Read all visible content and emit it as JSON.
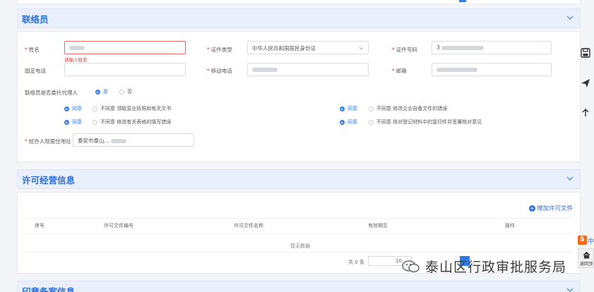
{
  "sections": {
    "contact": {
      "title": "联络员"
    },
    "license": {
      "title": "许可经营信息"
    },
    "seal": {
      "title": "印章备案信息"
    }
  },
  "contact": {
    "name_label": "姓名",
    "name_error": "请输入姓名",
    "id_type_label": "证件类型",
    "id_type_value": "中华人民共和国居民身份证",
    "id_number_label": "证件号码",
    "id_number_prefix": "3",
    "landline_label": "固定电话",
    "mobile_label": "移动电话",
    "email_label": "邮箱",
    "agent_question": "联络员是否委托代理人",
    "yes": "是",
    "no": "否",
    "agree": "同意",
    "disagree_pick_license": "不同意 领取营业执照和有关文书",
    "disagree_modify_docs": "不同意 修改企业自备文件的错误",
    "disagree_modify_forms": "不同意 修改有关表格的填写错误",
    "disagree_check_copies": "不同意 核对登记材料中的复印件并签署核对意见",
    "agent_address_label": "经办人现居住地址",
    "agent_address_value": "泰安市泰山…"
  },
  "license": {
    "add_button": "增加许可文件",
    "columns": [
      "序号",
      "许可文件编号",
      "许可文件名称",
      "有效期至",
      "操作"
    ],
    "empty_text": "暂无数据",
    "total_label": "共 0 条",
    "page_size_prefix": "10"
  },
  "watermark": {
    "text": "泰山区行政审批服务局"
  },
  "sidebar": {
    "back_top": "返回顶",
    "sogou_label": "中"
  },
  "colors": {
    "primary": "#2f7be5",
    "header_bg": "#e9f0fb",
    "error": "#e53935"
  }
}
